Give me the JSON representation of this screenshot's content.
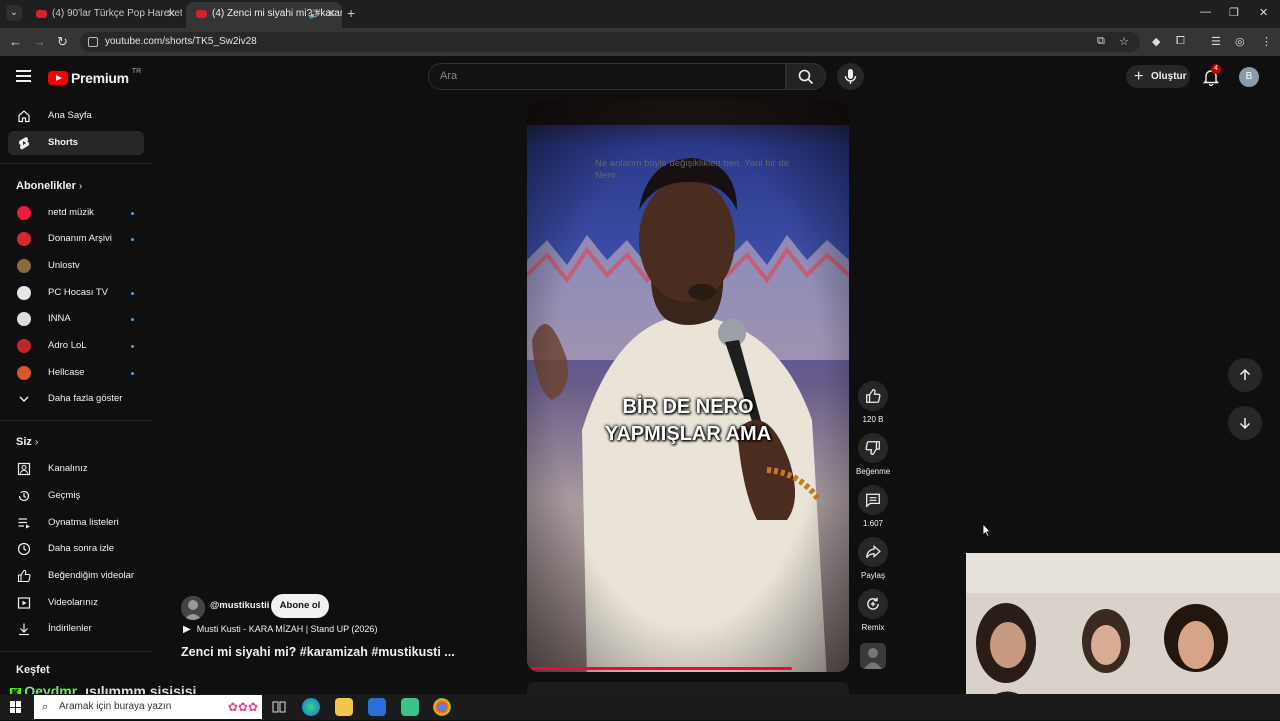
{
  "browser": {
    "tabs": [
      {
        "title": "(4) 90'lar Türkçe Pop Hareketli ·",
        "close": "✕"
      },
      {
        "title": "(4) Zenci mi siyahi mi? #karam",
        "close": "✕"
      }
    ],
    "new_tab": "+",
    "url": "youtube.com/shorts/TK5_Sw2iv28",
    "window_controls": {
      "minimize": "—",
      "restore": "❐",
      "close": "✕"
    }
  },
  "header": {
    "logo_text": "Premium",
    "country": "TR",
    "search_placeholder": "Ara",
    "create_label": "Oluştur",
    "notification_count": "4",
    "avatar_letter": "B"
  },
  "sidebar": {
    "main": [
      {
        "label": "Ana Sayfa",
        "icon": "home-icon"
      },
      {
        "label": "Shorts",
        "icon": "shorts-icon"
      }
    ],
    "subscriptions_title": "Abonelikler",
    "subscriptions": [
      {
        "label": "netd müzik",
        "color": "#e8203a",
        "new": true
      },
      {
        "label": "Donanım Arşivi",
        "color": "#d42a2a",
        "new": true
      },
      {
        "label": "Unlostv",
        "color": "#8a6a3a",
        "new": false
      },
      {
        "label": "PC Hocası TV",
        "color": "#e6e6e6",
        "new": true
      },
      {
        "label": "INNA",
        "color": "#dddddd",
        "new": true
      },
      {
        "label": "Adro LoL",
        "color": "#c0262c",
        "new": true
      },
      {
        "label": "Hellcase",
        "color": "#d8542a",
        "new": true
      }
    ],
    "show_more": "Daha fazla göster",
    "you_title": "Siz",
    "you": [
      {
        "label": "Kanalınız",
        "icon": "channel-icon"
      },
      {
        "label": "Geçmiş",
        "icon": "history-icon"
      },
      {
        "label": "Oynatma listeleri",
        "icon": "playlist-icon"
      },
      {
        "label": "Daha sonra izle",
        "icon": "clock-icon"
      },
      {
        "label": "Beğendiğim videolar",
        "icon": "thumbs-up-icon"
      },
      {
        "label": "Videolarınız",
        "icon": "video-icon"
      },
      {
        "label": "İndirilenler",
        "icon": "download-icon"
      }
    ],
    "explore_title": "Keşfet"
  },
  "video": {
    "caption_cc": "Ne anlarım böyle değişikliklen ben. Yani bir de Nero",
    "overlay_line1": "BİR DE NERO",
    "overlay_line2": "YAPMIŞLAR AMA",
    "progress": 0.83
  },
  "actions": {
    "likes": "120 B",
    "dislike": "Beğenme",
    "comments": "1.607",
    "share": "Paylaş",
    "remix": "Remix"
  },
  "meta": {
    "handle": "@mustikustii",
    "subscribe": "Abone ol",
    "track": "Musti Kusti - KARA MİZAH  | Stand UP (2026)",
    "title": "Zenci mi siyahi mi? #karamizah #mustikusti  ..."
  },
  "stream_overlay": {
    "name": "Qeydmr",
    "text": "ısılımmm şişişişi"
  },
  "taskbar": {
    "search_placeholder": "Aramak için buraya yazın"
  }
}
